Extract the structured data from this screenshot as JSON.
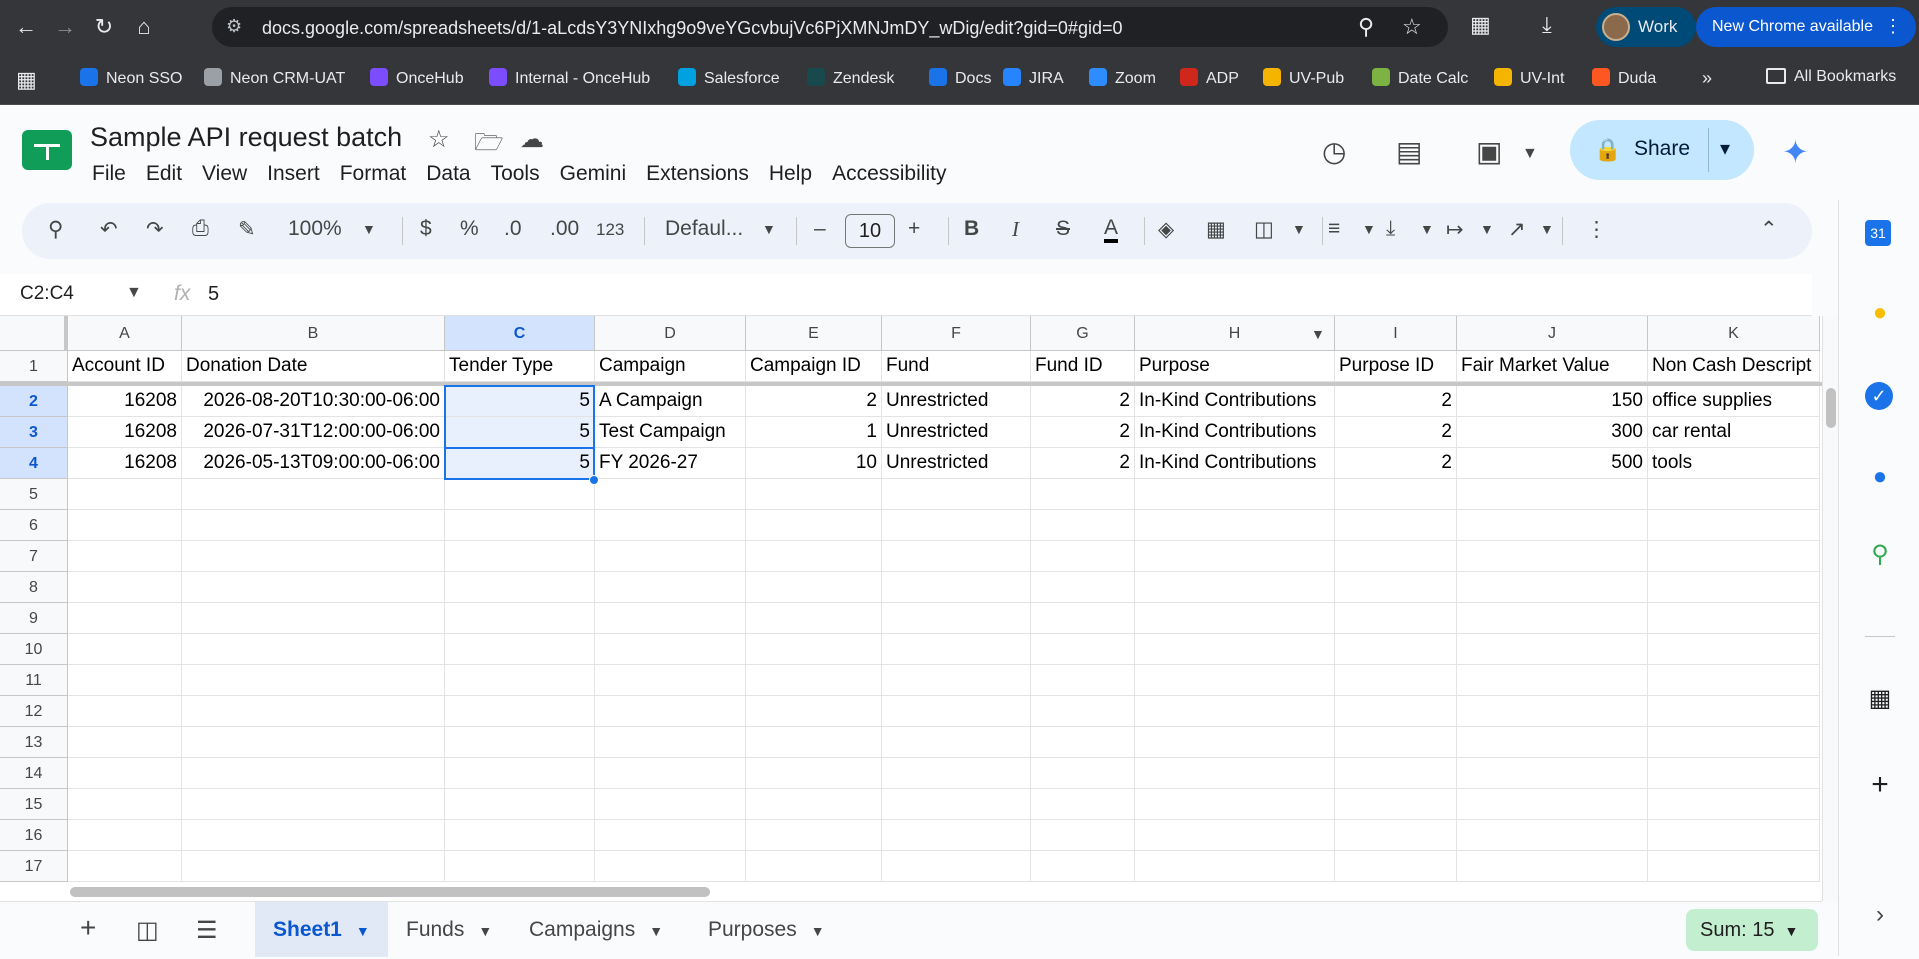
{
  "browser": {
    "url": "docs.google.com/spreadsheets/d/1-aLcdsY3YNIxhg9o9veYGcvbujVc6PjXMNJmDY_wDig/edit?gid=0#gid=0",
    "profile_label": "Work",
    "update_label": "New Chrome available",
    "bookmarks": [
      {
        "label": "Neon SSO",
        "color": "#1a73e8"
      },
      {
        "label": "Neon CRM-UAT",
        "color": "#9aa0a6"
      },
      {
        "label": "OnceHub",
        "color": "#7c4dff"
      },
      {
        "label": "Internal - OnceHub",
        "color": "#7c4dff"
      },
      {
        "label": "Salesforce",
        "color": "#00a1e0"
      },
      {
        "label": "Zendesk",
        "color": "#17494d"
      },
      {
        "label": "Docs",
        "color": "#1a73e8"
      },
      {
        "label": "JIRA",
        "color": "#2684ff"
      },
      {
        "label": "Zoom",
        "color": "#2d8cff"
      },
      {
        "label": "ADP",
        "color": "#d0271d"
      },
      {
        "label": "UV-Pub",
        "color": "#f4b400"
      },
      {
        "label": "Date Calc",
        "color": "#7cb342"
      },
      {
        "label": "UV-Int",
        "color": "#f4b400"
      },
      {
        "label": "Duda",
        "color": "#ff5722"
      }
    ],
    "more_label": "»",
    "all_bookmarks": "All Bookmarks"
  },
  "doc": {
    "title": "Sample API request batch",
    "menu": [
      "File",
      "Edit",
      "View",
      "Insert",
      "Format",
      "Data",
      "Tools",
      "Gemini",
      "Extensions",
      "Help",
      "Accessibility"
    ],
    "share_label": "Share"
  },
  "toolbar": {
    "zoom": "100%",
    "currency": "$",
    "percent": "%",
    "dec_decrease": ".0",
    "dec_increase": ".00",
    "number_format": "123",
    "font": "Defaul...",
    "font_size": "10",
    "bold": "B",
    "italic": "I",
    "text_color": "A"
  },
  "formula_bar": {
    "name_box": "C2:C4",
    "fx": "fx",
    "value": "5"
  },
  "columns": [
    "A",
    "B",
    "C",
    "D",
    "E",
    "F",
    "G",
    "H",
    "I",
    "J",
    "K"
  ],
  "rows": [
    "1",
    "2",
    "3",
    "4",
    "5",
    "6",
    "7",
    "8",
    "9",
    "10",
    "11",
    "12",
    "13",
    "14",
    "15",
    "16",
    "17"
  ],
  "header_row": [
    "Account ID",
    "Donation Date",
    "Tender Type",
    "Campaign",
    "Campaign ID",
    "Fund",
    "Fund ID",
    "Purpose",
    "Purpose ID",
    "Fair Market Value",
    "Non Cash Descript"
  ],
  "data_rows": [
    [
      "16208",
      "2026-08-20T10:30:00-06:00",
      "5",
      "A Campaign",
      "2",
      "Unrestricted",
      "2",
      "In-Kind Contributions",
      "2",
      "150",
      "office supplies"
    ],
    [
      "16208",
      "2026-07-31T12:00:00-06:00",
      "5",
      "Test Campaign",
      "1",
      "Unrestricted",
      "2",
      "In-Kind Contributions",
      "2",
      "300",
      "car rental"
    ],
    [
      "16208",
      "2026-05-13T09:00:00-06:00",
      "5",
      "FY 2026-27",
      "10",
      "Unrestricted",
      "2",
      "In-Kind Contributions",
      "2",
      "500",
      "tools"
    ]
  ],
  "sheets": [
    "Sheet1",
    "Funds",
    "Campaigns",
    "Purposes"
  ],
  "active_sheet": "Sheet1",
  "sum_label": "Sum: 15",
  "colors": {
    "accent": "#0b57d0",
    "selection": "#1a73e8",
    "share_bg": "#c2e7ff",
    "sum_bg": "#c4eed0"
  }
}
